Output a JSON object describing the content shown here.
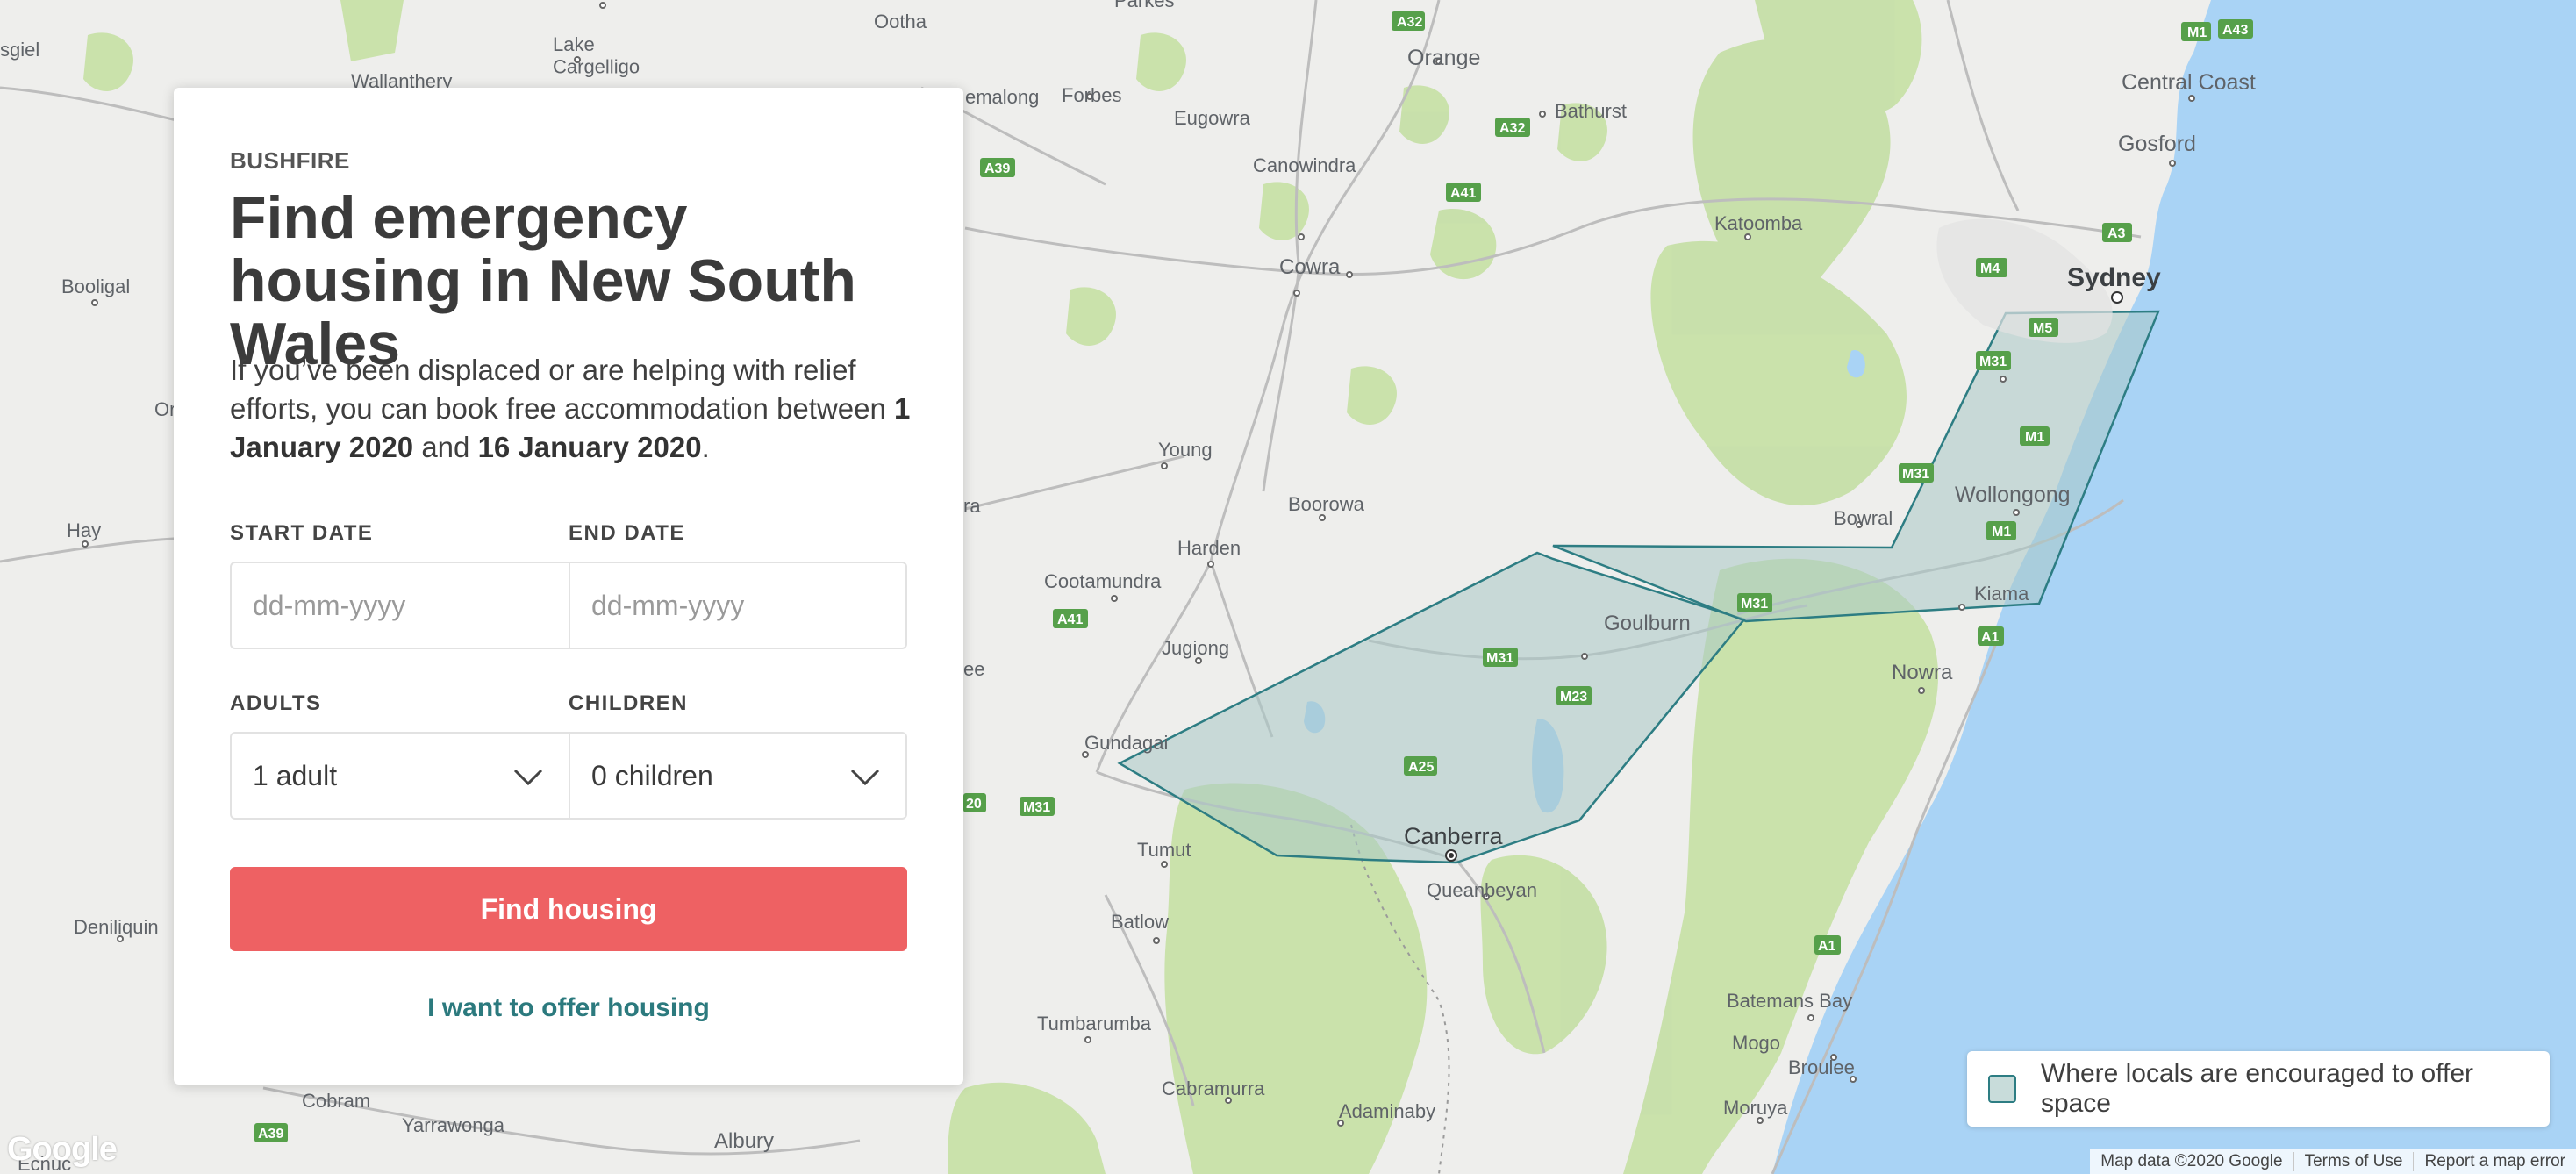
{
  "panel": {
    "eyebrow": "BUSHFIRE",
    "title": "Find emergency housing in New South Wales",
    "description_lead": "If you’ve been displaced or are helping with relief efforts, you can book free accommodation between",
    "start_date_text": "1 January 2020",
    "and_text": "and",
    "end_date_text": "16 January 2020",
    "period": ".",
    "start_date_label": "START DATE",
    "end_date_label": "END DATE",
    "start_date_placeholder": "dd-mm-yyyy",
    "end_date_placeholder": "dd-mm-yyyy",
    "adults_label": "ADULTS",
    "children_label": "CHILDREN",
    "adults_value": "1 adult",
    "children_value": "0 children",
    "find_button": "Find housing",
    "offer_link": "I want to offer housing"
  },
  "legend": {
    "text": "Where locals are encouraged to offer space"
  },
  "map": {
    "places": {
      "lake_cargelligo": "Lake\nCargelligo",
      "wallanthery": "Wallanthery",
      "ootha": "Ootha",
      "parkes": "Parkes",
      "orange": "Orange",
      "bathurst": "Bathurst",
      "emalong": "emalong",
      "forbes": "Forbes",
      "eugowra": "Eugowra",
      "canowindra": "Canowindra",
      "cowra": "Cowra",
      "katoomba": "Katoomba",
      "central_coast": "Central Coast",
      "gosford": "Gosford",
      "sydney": "Sydney",
      "booligal": "Booligal",
      "young": "Young",
      "boorowa": "Boorowa",
      "wollongong": "Wollongong",
      "bowral": "Bowral",
      "hay": "Hay",
      "harden": "Harden",
      "cootamundra": "Cootamundra",
      "goulburn": "Goulburn",
      "kiama": "Kiama",
      "jugiong": "Jugiong",
      "nowra": "Nowra",
      "gundagai": "Gundagai",
      "canberra": "Canberra",
      "queanbeyan": "Queanbeyan",
      "tumut": "Tumut",
      "deniliquin": "Deniliquin",
      "batlow": "Batlow",
      "batemans_bay": "Batemans Bay",
      "mogo": "Mogo",
      "broulee": "Broulee",
      "moruya": "Moruya",
      "tumbarumba": "Tumbarumba",
      "cobram": "Cobram",
      "yarrawonga": "Yarrawonga",
      "albury": "Albury",
      "cabramurra": "Cabramurra",
      "adaminaby": "Adaminaby",
      "or_fragment": "Or",
      "ra_fragment": "ra",
      "ee_fragment": "ee",
      "sgiel_fragment": "sgiel",
      "echuca_fragment": "Echuc"
    },
    "roads": [
      "A32",
      "M1",
      "A43",
      "A39",
      "A41",
      "A32",
      "A3",
      "M4",
      "M5",
      "M31",
      "M1",
      "M31",
      "M1",
      "A1",
      "M31",
      "M31",
      "A41",
      "M23",
      "A25",
      "20",
      "M31",
      "A1",
      "A39"
    ]
  },
  "footer": {
    "map_data": "Map data ©2020 Google",
    "terms": "Terms of Use",
    "report": "Report a map error"
  },
  "google_logo": "Google",
  "colors": {
    "accent_button": "#ee6163",
    "link_teal": "#2c7a7e",
    "region_fill": "#a9c9c6",
    "region_stroke": "#2d7d83",
    "ocean": "#a9d3f5",
    "land": "#eeeeec",
    "forest": "#c7e0a8"
  }
}
